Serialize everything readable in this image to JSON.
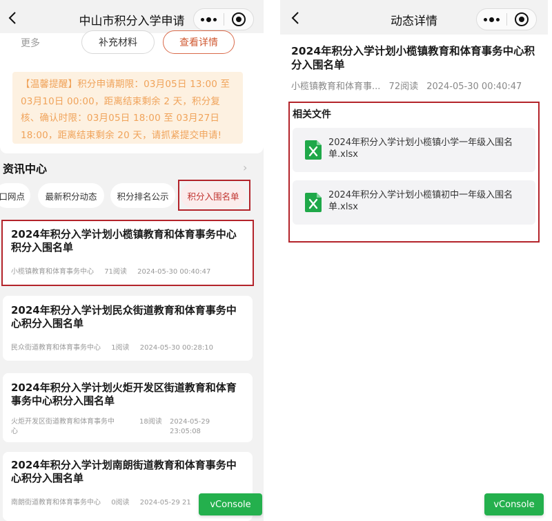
{
  "left": {
    "nav": {
      "title": "中山市积分入学申请"
    },
    "top": {
      "more_label": "更多",
      "supplement_label": "补充材料",
      "details_label": "查看详情",
      "notice": "【温馨提醒】积分申请期限：03月05日 13:00 至 03月10日 00:00，距离结束剩余 2 天，积分复核、确认时限：03月05日 18:00 至 03月27日 18:00，距离结束剩余 20 天，请抓紧提交申请!"
    },
    "section_title": "资讯中心",
    "tabs": [
      {
        "label": "口网点"
      },
      {
        "label": "最新积分动态"
      },
      {
        "label": "积分排名公示"
      },
      {
        "label": "积分入围名单"
      }
    ],
    "news": [
      {
        "title": "2024年积分入学计划小榄镇教育和体育事务中心积分入围名单",
        "source": "小榄镇教育和体育事务中心",
        "reads": "71阅读",
        "date": "2024-05-30 00:40:47"
      },
      {
        "title": "2024年积分入学计划民众街道教育和体育事务中心积分入围名单",
        "source": "民众街道教育和体育事务中心",
        "reads": "1阅读",
        "date": "2024-05-30 00:28:10"
      },
      {
        "title": "2024年积分入学计划火炬开发区街道教育和体育事务中心积分入围名单",
        "source_line1": "火炬开发区街道教育和体育事务中",
        "source_line2": "心",
        "reads": "18阅读",
        "date_line1": "2024-05-29",
        "date_line2": "23:05:08"
      },
      {
        "title": "2024年积分入学计划南朗街道教育和体育事务中心积分入围名单",
        "source": "南朗街道教育和体育事务中心",
        "reads": "0阅读",
        "date": "2024-05-29 21"
      }
    ],
    "vconsole": "vConsole"
  },
  "right": {
    "nav": {
      "title": "动态详情"
    },
    "title": "2024年积分入学计划小榄镇教育和体育事务中心积分入围名单",
    "meta": {
      "source": "小榄镇教育和体育事...",
      "reads": "72阅读",
      "date": "2024-05-30 00:40:47"
    },
    "files_label": "相关文件",
    "files": [
      {
        "name": "2024年积分入学计划小榄镇小学一年级入围名单.xlsx",
        "icon": "excel-file-icon"
      },
      {
        "name": "2024年积分入学计划小榄镇初中一年级入围名单.xlsx",
        "icon": "excel-file-icon"
      }
    ],
    "vconsole": "vConsole"
  },
  "colors": {
    "accent_red": "#b3232a",
    "notice_bg": "#fdf1e1",
    "notice_text": "#f0a35a",
    "vconsole_green": "#24b04d",
    "excel_green": "#1fa849"
  }
}
